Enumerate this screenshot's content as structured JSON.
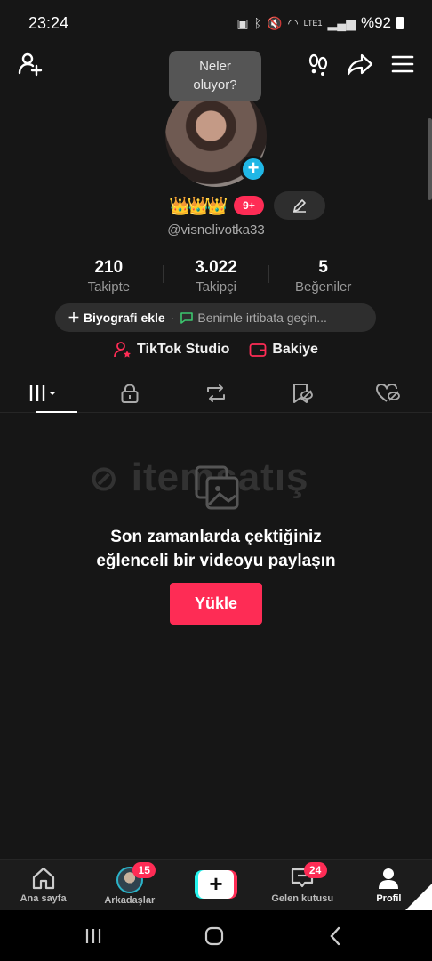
{
  "status_bar": {
    "time": "23:24",
    "battery": "%92",
    "network": "LTE1"
  },
  "tooltip": {
    "line1": "Neler",
    "line2": "oluyor?"
  },
  "profile": {
    "level_badge": "9+",
    "username": "@visnelivotka33"
  },
  "stats": [
    {
      "value": "210",
      "label": "Takipte"
    },
    {
      "value": "3.022",
      "label": "Takipçi"
    },
    {
      "value": "5",
      "label": "Beğeniler"
    }
  ],
  "bio": {
    "add_label": "Biyografi ekle",
    "separator": "·",
    "contact_label": "Benimle irtibata geçin..."
  },
  "links": {
    "studio": "TikTok Studio",
    "balance": "Bakiye"
  },
  "watermark": "itemsatış",
  "empty_state": {
    "line1": "Son zamanlarda çektiğiniz",
    "line2": "eğlenceli bir videoyu paylaşın",
    "upload_label": "Yükle"
  },
  "bottom_nav": {
    "home": "Ana sayfa",
    "friends": "Arkadaşlar",
    "friends_badge": "15",
    "create": "+",
    "inbox": "Gelen kutusu",
    "inbox_badge": "24",
    "profile": "Profil"
  },
  "colors": {
    "accent": "#fe2c55",
    "cyan": "#25f4ee",
    "background": "#161616"
  }
}
